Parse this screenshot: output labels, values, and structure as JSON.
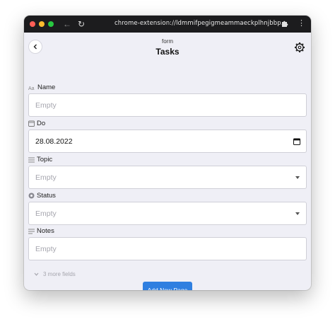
{
  "browser": {
    "url": "chrome-extension://ldmmifpegigmeammaeckplhnjbbp...",
    "traffic_lights": [
      "#ff5f57",
      "#febc2e",
      "#28c840"
    ]
  },
  "header": {
    "subtitle": "form",
    "title": "Tasks"
  },
  "fields": {
    "name": {
      "label": "Name",
      "placeholder": "Empty",
      "icon": "text-icon"
    },
    "do": {
      "label": "Do",
      "value": "28.08.2022",
      "icon": "calendar-icon"
    },
    "topic": {
      "label": "Topic",
      "placeholder": "Empty",
      "icon": "list-icon"
    },
    "status": {
      "label": "Status",
      "placeholder": "Empty",
      "icon": "status-icon"
    },
    "notes": {
      "label": "Notes",
      "placeholder": "Empty",
      "icon": "notes-icon"
    }
  },
  "more_fields": "3 more fields",
  "add_button": "Add New Page",
  "colors": {
    "accent": "#2f7fe0",
    "background": "#efeff6",
    "titlebar": "#1c1c1e"
  }
}
